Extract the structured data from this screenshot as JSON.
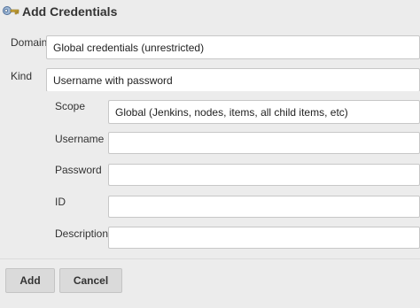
{
  "dialog": {
    "title": "Add Credentials",
    "icon": "key-icon"
  },
  "form": {
    "domain": {
      "label": "Domain",
      "value": "Global credentials (unrestricted)"
    },
    "kind": {
      "label": "Kind",
      "value": "Username with password"
    },
    "scope": {
      "label": "Scope",
      "value": "Global (Jenkins, nodes, items, all child items, etc)"
    },
    "username": {
      "label": "Username",
      "value": ""
    },
    "password": {
      "label": "Password",
      "value": ""
    },
    "id": {
      "label": "ID",
      "value": ""
    },
    "description": {
      "label": "Description",
      "value": ""
    }
  },
  "buttons": {
    "add_label": "Add",
    "cancel_label": "Cancel"
  }
}
